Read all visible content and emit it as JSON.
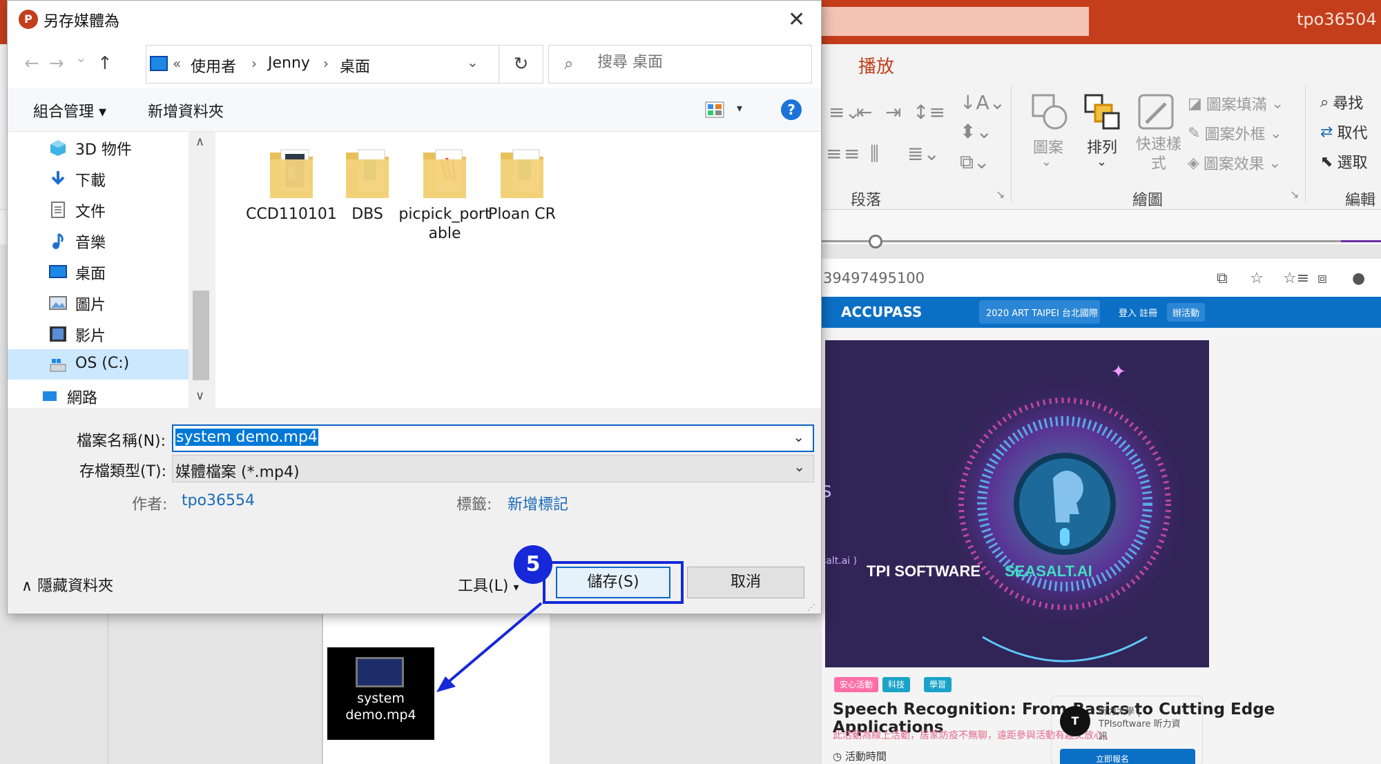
{
  "dialog": {
    "title": "另存媒體為",
    "close_symbol": "✕",
    "nav": {
      "back": "←",
      "forward": "→",
      "recent": "⌄",
      "up": "↑",
      "breadcrumb_prefix": "«",
      "breadcrumb": [
        "使用者",
        "Jenny",
        "桌面"
      ],
      "breadcrumb_chevron": "⌄",
      "refresh": "↻",
      "search_placeholder": "搜尋 桌面"
    },
    "toolbar": {
      "organize": "組合管理 ▾",
      "new_folder": "新增資料夾",
      "view_dropdown": "▾",
      "help": "?"
    },
    "nav_pane": {
      "items": [
        {
          "label": "3D 物件",
          "icon": "cube-icon"
        },
        {
          "label": "下載",
          "icon": "download-icon"
        },
        {
          "label": "文件",
          "icon": "document-icon"
        },
        {
          "label": "音樂",
          "icon": "music-icon"
        },
        {
          "label": "桌面",
          "icon": "desktop-icon"
        },
        {
          "label": "圖片",
          "icon": "picture-icon"
        },
        {
          "label": "影片",
          "icon": "video-icon"
        },
        {
          "label": "OS (C:)",
          "icon": "drive-icon",
          "selected": true
        },
        {
          "label": "網路",
          "icon": "network-icon"
        }
      ]
    },
    "files": [
      {
        "name": "CCD110101",
        "icon": "folder-icon"
      },
      {
        "name": "DBS",
        "icon": "folder-icon"
      },
      {
        "name": "picpick_portable",
        "icon": "folder-icon"
      },
      {
        "name": "Ploan CR",
        "icon": "folder-icon"
      }
    ],
    "file_name_label": "檔案名稱(N):",
    "file_name_value": "system demo.mp4",
    "file_type_label": "存檔類型(T):",
    "file_type_value": "媒體檔案 (*.mp4)",
    "author_label": "作者:",
    "author_value": "tpo36554",
    "tags_label": "標籤:",
    "tags_value": "新增標記",
    "hide_folders": "隱藏資料夾",
    "hide_folders_chevron": "∧",
    "tools": "工具(L)",
    "tools_chevron": "▾",
    "save": "儲存(S)",
    "cancel": "取消"
  },
  "annotation": {
    "step": "5",
    "color": "#1628d8"
  },
  "dragged_file": {
    "name": "system demo.mp4"
  },
  "powerpoint": {
    "user": "tpo36504",
    "tab_active": "播放",
    "ribbon": {
      "paragraph_group": "段落",
      "drawing_group": "繪圖",
      "editing_group": "編輯",
      "shapes": "圖案",
      "arrange": "排列",
      "quick_styles": "快速樣式",
      "shape_fill": "圖案填滿",
      "shape_outline": "圖案外框",
      "shape_effects": "圖案效果",
      "find": "尋找",
      "replace": "取代",
      "select": "選取"
    },
    "accent_color": "#c43e1c"
  },
  "browser": {
    "url_fragment": "39497495100",
    "site_logo": "ACCUPASS",
    "site_search": "2020 ART TAIPEI 台北國際",
    "site_links": "登入  註冊",
    "site_button": "辦活動",
    "banner_partial_1": "s",
    "banner_partial_2": "salt.ai )",
    "banner_brand_1": "TPI SOFTWARE",
    "banner_brand_2": "SEASALT.AI",
    "tags": [
      "安心活動",
      "科技",
      "學習"
    ],
    "event_title": "Speech Recognition: From Basics to Cutting Edge Applications",
    "event_notice": "此活動為線上活動，居家防疫不無聊，遠距參與活動有趣又放心。",
    "event_time_label": "活動時間",
    "organizer": "昕力大學 | TPIsoftware 昕力資訊",
    "organizer_button": "立即報名"
  }
}
